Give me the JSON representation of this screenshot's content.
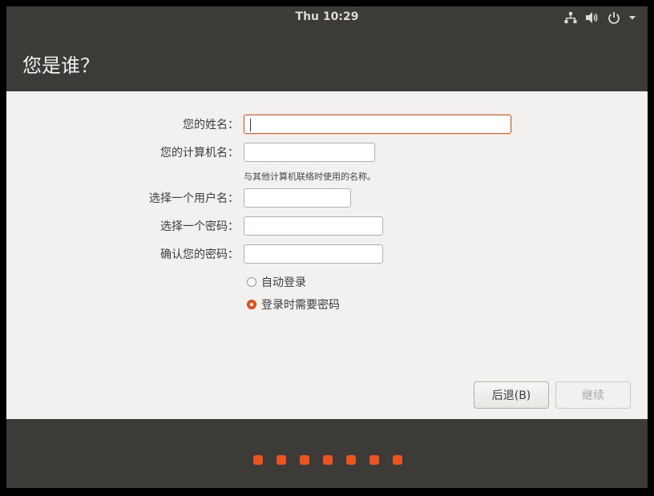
{
  "topbar": {
    "clock": "Thu 10:29",
    "icons": [
      "network-icon",
      "volume-icon",
      "power-icon",
      "chevron-down-icon"
    ]
  },
  "header": {
    "title": "您是谁？"
  },
  "form": {
    "name_label": "您的姓名：",
    "name_value": "",
    "computer_label": "您的计算机名：",
    "computer_value": "",
    "computer_hint": "与其他计算机联络时使用的名称。",
    "username_label": "选择一个用户名：",
    "username_value": "",
    "password_label": "选择一个密码：",
    "password_value": "",
    "confirm_label": "确认您的密码：",
    "confirm_value": "",
    "auto_login_label": "自动登录",
    "require_password_label": "登录时需要密码",
    "selected_login_option": "require_password"
  },
  "buttons": {
    "back_label": "后退(B)",
    "continue_label": "继续"
  },
  "progress": {
    "total_steps": 7
  },
  "colors": {
    "accent": "#e95420",
    "chrome": "#3c3b37",
    "content_bg": "#f2f1f0"
  }
}
